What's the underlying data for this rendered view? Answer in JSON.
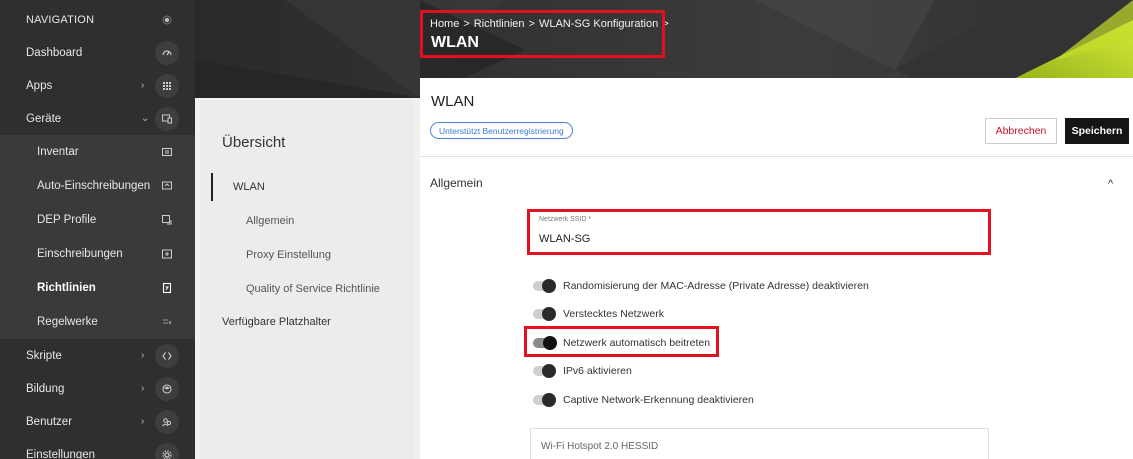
{
  "nav": {
    "header": "NAVIGATION",
    "items": [
      {
        "label": "Dashboard",
        "icon": "gauge-icon",
        "chevron": ""
      },
      {
        "label": "Apps",
        "icon": "grid-icon",
        "chevron": "›"
      },
      {
        "label": "Geräte",
        "icon": "devices-icon",
        "chevron": "⌄"
      },
      {
        "label": "Inventar",
        "icon": "inventory-icon",
        "chevron": ""
      },
      {
        "label": "Auto-Einschreibungen",
        "icon": "auto-enroll-icon",
        "chevron": ""
      },
      {
        "label": "DEP Profile",
        "icon": "dep-icon",
        "chevron": ""
      },
      {
        "label": "Einschreibungen",
        "icon": "enroll-icon",
        "chevron": ""
      },
      {
        "label": "Richtlinien",
        "icon": "policy-icon",
        "chevron": ""
      },
      {
        "label": "Regelwerke",
        "icon": "rules-icon",
        "chevron": ""
      },
      {
        "label": "Skripte",
        "icon": "code-icon",
        "chevron": "›"
      },
      {
        "label": "Bildung",
        "icon": "graduation-icon",
        "chevron": "›"
      },
      {
        "label": "Benutzer",
        "icon": "users-icon",
        "chevron": "›"
      },
      {
        "label": "Einstellungen",
        "icon": "gear-icon",
        "chevron": ""
      }
    ]
  },
  "breadcrumb": {
    "items": [
      "Home",
      "Richtlinien",
      "WLAN-SG Konfiguration"
    ],
    "separator": ">"
  },
  "page_title": "WLAN",
  "overview": {
    "title": "Übersicht",
    "items": [
      "WLAN",
      "Allgemein",
      "Proxy Einstellung",
      "Quality of Service Richtlinie",
      "Verfügbare Platzhalter"
    ]
  },
  "panel": {
    "title": "WLAN",
    "badge": "Unterstützt Benutzerregistrierung",
    "cancel_label": "Abbrechen",
    "save_label": "Speichern",
    "section_title": "Allgemein",
    "section_caret": "^",
    "ssid": {
      "label": "Netzwerk SSID *",
      "value": "WLAN-SG"
    },
    "toggles": [
      {
        "label": "Randomisierung der MAC-Adresse (Private Adresse) deaktivieren",
        "on": false
      },
      {
        "label": "Verstecktes Netzwerk",
        "on": false
      },
      {
        "label": "Netzwerk automatisch beitreten",
        "on": true
      },
      {
        "label": "IPv6 aktivieren",
        "on": false
      },
      {
        "label": "Captive Network-Erkennung deaktivieren",
        "on": false
      }
    ],
    "hotspot_label": "Wi-Fi Hotspot 2.0 HESSID"
  },
  "colors": {
    "highlight": "#e3101f",
    "accent_green": "#b7d21c",
    "link_blue": "#3d7bd0",
    "cancel_red": "#c8102e"
  }
}
